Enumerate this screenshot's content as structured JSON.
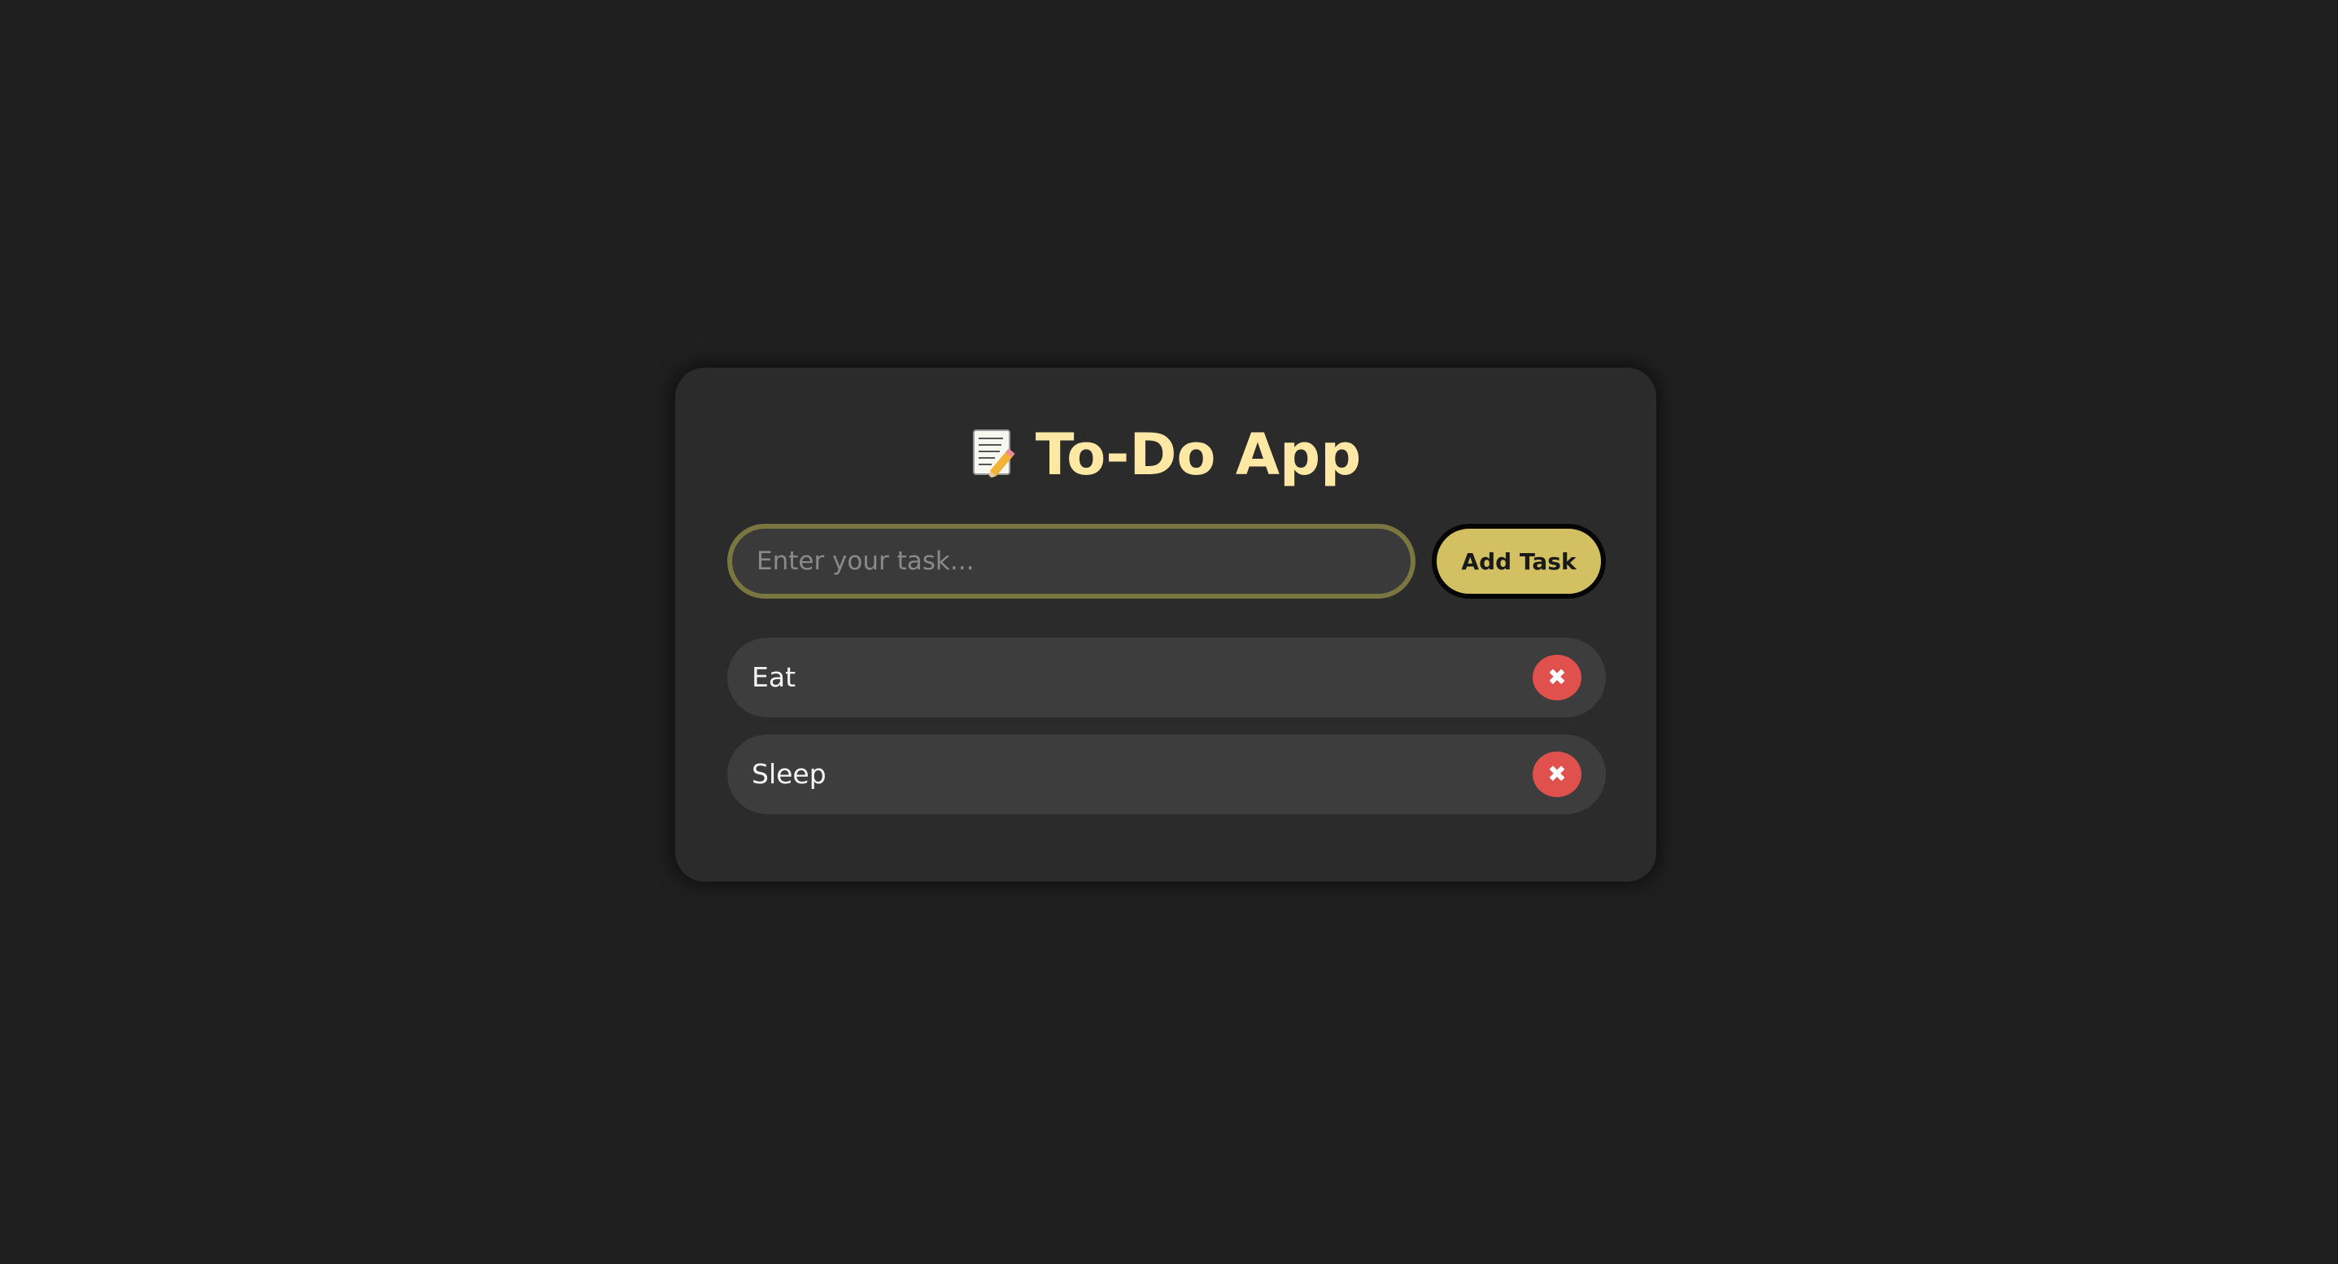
{
  "app": {
    "title": "To-Do App",
    "title_icon": "memo-pencil-icon"
  },
  "input": {
    "placeholder": "Enter your task...",
    "value": ""
  },
  "add_button": {
    "label": "Add Task"
  },
  "tasks": [
    {
      "text": "Eat",
      "delete_glyph": "✖"
    },
    {
      "text": "Sleep",
      "delete_glyph": "✖"
    }
  ],
  "colors": {
    "background": "#1f1f1f",
    "card": "#2b2b2b",
    "title": "#ffe8a3",
    "accent": "#d2c062",
    "delete": "#e0504c",
    "task_row": "#3d3d3d"
  }
}
